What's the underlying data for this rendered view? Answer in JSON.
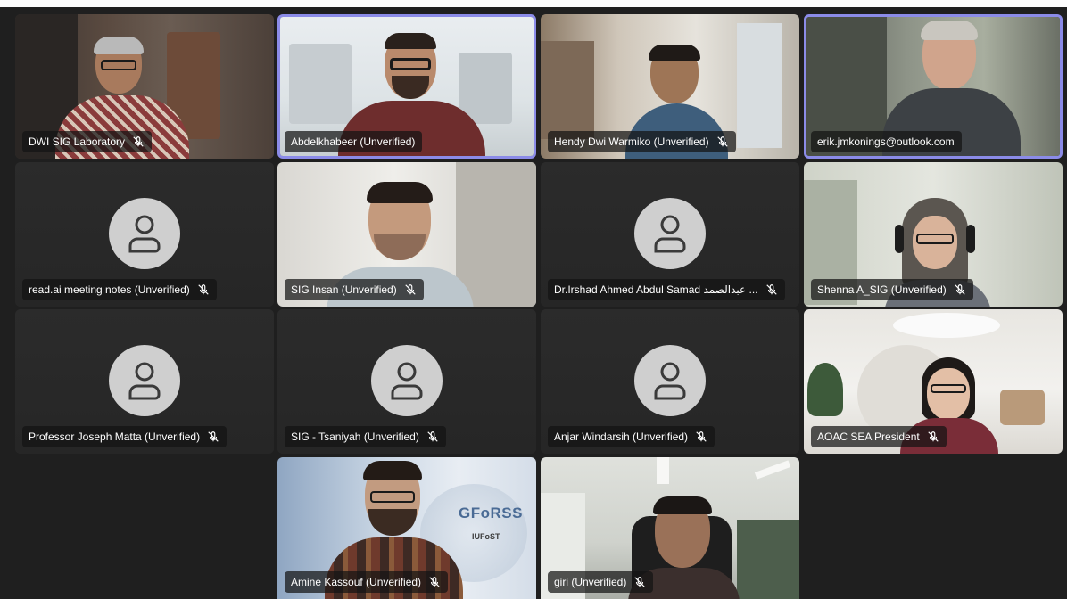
{
  "meeting": {
    "participants": [
      {
        "name": "DWI SIG Laboratory",
        "muted": true,
        "video": true,
        "active": false
      },
      {
        "name": "Abdelkhabeer (Unverified)",
        "muted": false,
        "video": true,
        "active": true
      },
      {
        "name": "Hendy Dwi Warmiko (Unverified)",
        "muted": true,
        "video": true,
        "active": false
      },
      {
        "name": "erik.jmkonings@outlook.com",
        "muted": false,
        "video": true,
        "active": true
      },
      {
        "name": "read.ai meeting notes (Unverified)",
        "muted": true,
        "video": false,
        "active": false
      },
      {
        "name": "SIG Insan (Unverified)",
        "muted": true,
        "video": true,
        "active": false
      },
      {
        "name": "Dr.Irshad Ahmed Abdul Samad عبدالصمد ...",
        "muted": true,
        "video": false,
        "active": false
      },
      {
        "name": "Shenna A_SIG (Unverified)",
        "muted": true,
        "video": true,
        "active": false
      },
      {
        "name": "Professor Joseph Matta (Unverified)",
        "muted": true,
        "video": false,
        "active": false
      },
      {
        "name": "SIG - Tsaniyah (Unverified)",
        "muted": true,
        "video": false,
        "active": false
      },
      {
        "name": "Anjar Windarsih (Unverified)",
        "muted": true,
        "video": false,
        "active": false
      },
      {
        "name": "AOAC SEA President",
        "muted": true,
        "video": true,
        "active": false
      },
      {
        "name": "Amine Kassouf (Unverified)",
        "muted": true,
        "video": true,
        "active": false
      },
      {
        "name": "giri (Unverified)",
        "muted": true,
        "video": true,
        "active": false
      }
    ],
    "background_logo": {
      "text": "GFoRSS",
      "subtext": "IUFoST"
    }
  },
  "colors": {
    "background": "#1f1f1f",
    "tile": "#292929",
    "active_border": "#8b8be8",
    "avatar": "#cfcfcf",
    "avatar_glyph": "#3a3a3a",
    "label_bg": "rgba(20,20,20,0.72)"
  },
  "icons": {
    "mic_off": "mic-off-icon",
    "avatar": "person-avatar-icon"
  }
}
